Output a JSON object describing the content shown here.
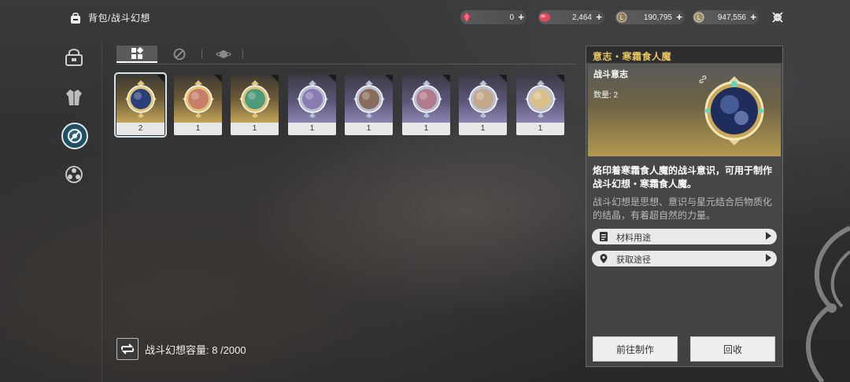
{
  "header": {
    "title": "背包/战斗幻想",
    "currencies": [
      {
        "icon": "red-crystal-icon",
        "value": "0",
        "color": "#d2334b"
      },
      {
        "icon": "red-gem-icon",
        "value": "2,464",
        "color": "#e04b5a"
      },
      {
        "icon": "coin-icon",
        "value": "190,795",
        "color": "#b9a77a"
      },
      {
        "icon": "coin-icon",
        "value": "947,556",
        "color": "#c9b98a"
      }
    ],
    "plus": "+"
  },
  "tabs": [
    "all-tab",
    "fantasy-tab",
    "planet-tab"
  ],
  "items": [
    {
      "count": "2",
      "rarity": "gold",
      "orb": "#2b3f7a"
    },
    {
      "count": "1",
      "rarity": "gold",
      "orb": "#c87d6a"
    },
    {
      "count": "1",
      "rarity": "gold",
      "orb": "#4d9a7a"
    },
    {
      "count": "1",
      "rarity": "purple",
      "orb": "#8a7bb0"
    },
    {
      "count": "1",
      "rarity": "purple",
      "orb": "#8a6c5a"
    },
    {
      "count": "1",
      "rarity": "purple",
      "orb": "#b07b8a"
    },
    {
      "count": "1",
      "rarity": "purple",
      "orb": "#c4a88a"
    },
    {
      "count": "1",
      "rarity": "purple",
      "orb": "#d8c08a"
    }
  ],
  "capacity": {
    "text": "战斗幻想容量: 8 /2000"
  },
  "detail": {
    "title": "意志・寒霜食人魔",
    "type": "战斗意志",
    "quantity": "数量: 2",
    "description": "烙印着寒霜食人魔的战斗意识，可用于制作战斗幻想・寒霜食人魔。",
    "lore": "战斗幻想是思想、意识与星元结合后物质化的结晶，有着超自然的力量。",
    "links": [
      "材料用途",
      "获取途径"
    ],
    "buttons": {
      "craft": "前往制作",
      "recycle": "回收"
    }
  },
  "colors": {
    "accent_gold": "#e7c55f",
    "selected_nav": "#2c6f86"
  }
}
